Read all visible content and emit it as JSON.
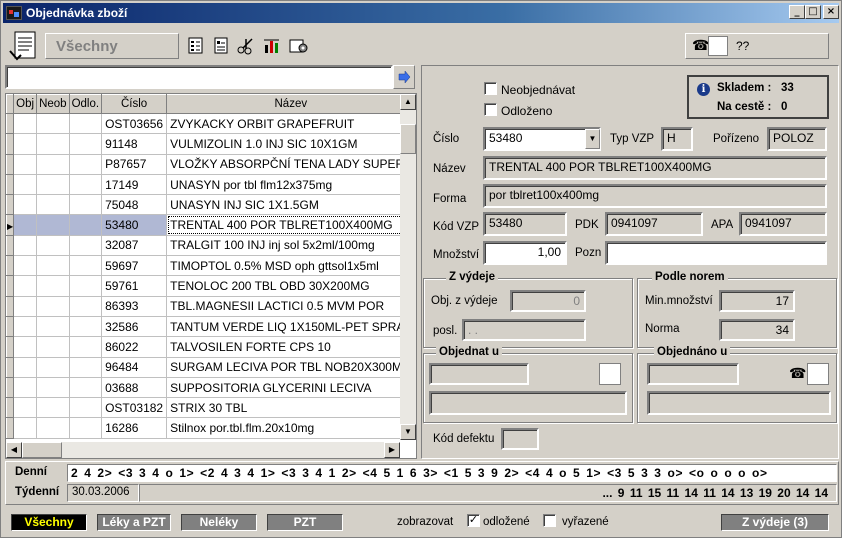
{
  "window": {
    "title": "Objednávka zboží"
  },
  "toolbar": {
    "filter_label": "Všechny",
    "phone_value": "??"
  },
  "grid": {
    "columns": [
      "Obj",
      "Neob",
      "Odlo.",
      "Číslo",
      "Název"
    ],
    "rows": [
      {
        "cislo": "OST03656",
        "nazev": "ZVYKACKY ORBIT GRAPEFRUIT"
      },
      {
        "cislo": "91148",
        "nazev": "VULMIZOLIN 1.0 INJ SIC 10X1GM"
      },
      {
        "cislo": "P87657",
        "nazev": "VLOŽKY ABSORPČNÍ TENA LADY SUPER"
      },
      {
        "cislo": "17149",
        "nazev": "UNASYN por tbl flm12x375mg"
      },
      {
        "cislo": "75048",
        "nazev": "UNASYN INJ SIC 1X1.5GM"
      },
      {
        "cislo": "53480",
        "nazev": "TRENTAL 400 POR TBLRET100X400MG"
      },
      {
        "cislo": "32087",
        "nazev": "TRALGIT 100 INJ inj sol 5x2ml/100mg"
      },
      {
        "cislo": "59697",
        "nazev": "TIMOPTOL 0.5% MSD oph gttsol1x5ml"
      },
      {
        "cislo": "59761",
        "nazev": "TENOLOC 200 TBL OBD 30X200MG"
      },
      {
        "cislo": "86393",
        "nazev": "TBL.MAGNESII LACTICI 0.5 MVM POR"
      },
      {
        "cislo": "32586",
        "nazev": "TANTUM VERDE LIQ 1X150ML-PET SPRAY"
      },
      {
        "cislo": "86022",
        "nazev": "TALVOSILEN FORTE CPS 10"
      },
      {
        "cislo": "96484",
        "nazev": "SURGAM LECIVA POR TBL NOB20X300MG"
      },
      {
        "cislo": "03688",
        "nazev": "SUPPOSITORIA GLYCERINI LECIVA"
      },
      {
        "cislo": "OST03182",
        "nazev": "STRIX  30 TBL"
      },
      {
        "cislo": "16286",
        "nazev": "Stilnox por.tbl.flm.20x10mg"
      }
    ]
  },
  "detail": {
    "neobjednavat_label": "Neobjednávat",
    "odlozeno_label": "Odloženo",
    "skladem_label": "Skladem :",
    "skladem_value": "33",
    "na_ceste_label": "Na cestě :",
    "na_ceste_value": "0",
    "cislo_label": "Číslo",
    "cislo_value": "53480",
    "typ_vzp_label": "Typ VZP",
    "typ_vzp_value": "H",
    "porizeno_label": "Pořízeno",
    "porizeno_value": "POLOZ",
    "nazev_label": "Název",
    "nazev_value": "TRENTAL 400 POR TBLRET100X400MG",
    "forma_label": "Forma",
    "forma_value": "por tblret100x400mg",
    "kod_vzp_label": "Kód VZP",
    "kod_vzp_value": "53480",
    "pdk_label": "PDK",
    "pdk_value": "0941097",
    "apa_label": "APA",
    "apa_value": "0941097",
    "mnozstvi_label": "Množství",
    "mnozstvi_value": "1,00",
    "pozn_label": "Pozn",
    "pozn_value": ""
  },
  "z_vydeje": {
    "title": "Z výdeje",
    "obj_label": "Obj. z výdeje",
    "obj_value": "0",
    "posl_label": "posl.",
    "posl_value": ". ."
  },
  "podle_norem": {
    "title": "Podle norem",
    "min_label": "Min.množství",
    "min_value": "17",
    "norma_label": "Norma",
    "norma_value": "34"
  },
  "objednat_u": {
    "title": "Objednat u"
  },
  "objednano_u": {
    "title": "Objednáno u"
  },
  "kod_defektu_label": "Kód defektu",
  "history": {
    "denni_label": "Denní",
    "tydenni_label": "Týdenní",
    "denni_values": "2 4 2> <3 3 4 o 1> <2 4 3 4 1> <3 3 4 1 2> <4 5 1 6 3> <1 5 3 9 2> <4 4 o 5 1> <3 5 3 3 o> <o o o o o>",
    "tydenni_date": "30.03.2006",
    "tydenni_values": "... 9 11 15 11 14 11 14 13 19 20 14 14"
  },
  "bottom": {
    "tab_vsechny": "Všechny",
    "tab_leky": "Léky a PZT",
    "tab_neleky": "Neléky",
    "tab_pzt": "PZT",
    "zobrazovat_label": "zobrazovat",
    "odlozene_label": "odložené",
    "odlozene_checked": "✓",
    "vyrazene_label": "vyřazené",
    "z_vydeje_button": "Z výdeje (3)"
  },
  "colors": {
    "title_start": "#0a246a",
    "selected_row": "#b0b8d4",
    "active_tab_text": "#ffff00"
  }
}
